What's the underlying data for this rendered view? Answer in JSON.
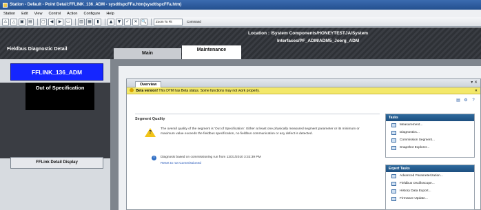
{
  "window": {
    "title": "Station - Default - Point Detail:FFLINK_136_ADM - sysdtlspcFFa.htm(sysdtlspcFFa.htm)"
  },
  "menu": [
    "Station",
    "Edit",
    "View",
    "Control",
    "Action",
    "Configure",
    "Help"
  ],
  "toolbar": {
    "zoom_value": "Zoom To Fit",
    "command_label": "Command"
  },
  "left_panel": {
    "header": "Fieldbus Diagnostic Detail",
    "device_name": "FFLINK_136_ADM",
    "status": "Out of Specification",
    "detail_button": "FFLink Detail Display"
  },
  "header": {
    "location_line1": "Location : /System Components/HONEYTESTJA/System",
    "location_line2": "Interfaces/PF_ADM/ADM5_Joerg_ADM"
  },
  "tabs": {
    "main": "Main",
    "maintenance": "Maintenance"
  },
  "dtm": {
    "overview_tab": "Overview",
    "beta_label": "Beta version!",
    "beta_text": "This DTM has Beta status. Some functions may not work properly.",
    "segment_quality_title": "Segment Quality",
    "segment_text": "The overall quality of the segment is 'Out of Specification'. Either at least one physically measured segment parameter or its minimum or maximum value exceeds the fieldbus specification, no fieldbus communication or any defect is detected.",
    "diagnosis_text": "Diagnosis based on commissioning run from 12/21/2010 3:32:39 PM",
    "reset_link": "Reset to not Commissioned"
  },
  "tasks": {
    "title": "Tasks",
    "items": [
      "Measurement...",
      "Diagnostics...",
      "Commission Segment...",
      "Snapshot Explorer..."
    ]
  },
  "expert_tasks": {
    "title": "Expert Tasks",
    "items": [
      "Advanced Parameterization...",
      "Fieldbus Oscilloscope...",
      "History Data Export...",
      "Firmware Update..."
    ]
  }
}
